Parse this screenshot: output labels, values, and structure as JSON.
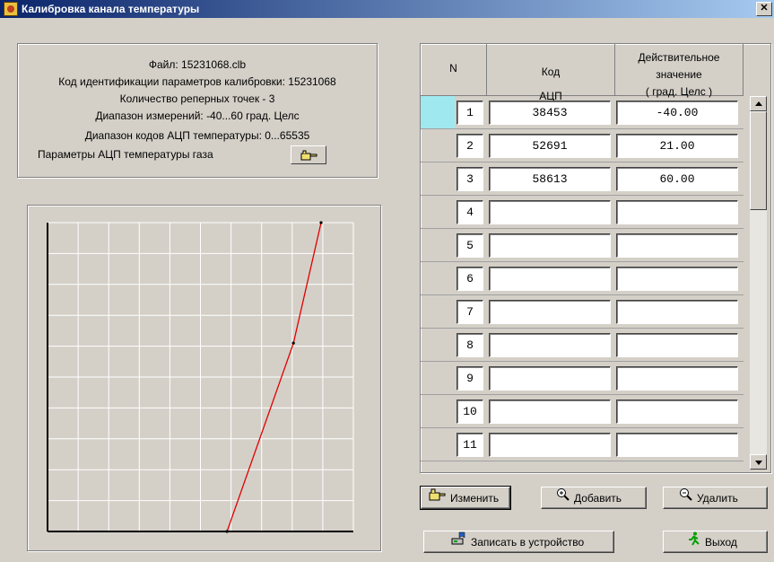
{
  "window": {
    "title": "Калибровка канала температуры",
    "close_glyph": "✕",
    "app_icon": "calibration-app-icon"
  },
  "info": {
    "file_line": "Файл:  15231068.clb",
    "id_line": "Код идентификации параметров калибровки:  15231068",
    "points_line": "Количество реперных точек -   3",
    "range_line": "Диапазон измерений:  -40...60 град. Целс",
    "adc_range_line": "Диапазон кодов АЦП температуры:  0...65535",
    "adc_params_label": "Параметры АЦП температуры газа",
    "adc_params_icon": "pointing-hand-icon"
  },
  "chart_data": {
    "type": "line",
    "title": "",
    "xlabel": "",
    "ylabel": "",
    "grid": true,
    "series": [
      {
        "x": [
          38453,
          52691,
          58613
        ],
        "y": [
          -40.0,
          21.0,
          60.0
        ],
        "color": "#e00000"
      }
    ]
  },
  "table": {
    "headers": {
      "n": "N",
      "code": [
        "Код",
        "АЦП"
      ],
      "value": [
        "Действительное",
        "значение",
        "( град. Целс )"
      ]
    },
    "rows": [
      {
        "n": "1",
        "code": "38453",
        "value": "-40.00"
      },
      {
        "n": "2",
        "code": "52691",
        "value": "21.00"
      },
      {
        "n": "3",
        "code": "58613",
        "value": "60.00"
      },
      {
        "n": "4",
        "code": "",
        "value": ""
      },
      {
        "n": "5",
        "code": "",
        "value": ""
      },
      {
        "n": "6",
        "code": "",
        "value": ""
      },
      {
        "n": "7",
        "code": "",
        "value": ""
      },
      {
        "n": "8",
        "code": "",
        "value": ""
      },
      {
        "n": "9",
        "code": "",
        "value": ""
      },
      {
        "n": "10",
        "code": "",
        "value": ""
      },
      {
        "n": "11",
        "code": "",
        "value": ""
      }
    ],
    "selected_row": 0
  },
  "buttons": {
    "edit": {
      "label": "Изменить",
      "icon": "edit-hand-icon"
    },
    "add": {
      "label": "Добавить",
      "icon": "zoom-in-icon"
    },
    "delete": {
      "label": "Удалить",
      "icon": "zoom-out-icon"
    },
    "write": {
      "label": "Записать в устройство",
      "icon": "write-device-icon"
    },
    "exit": {
      "label": "Выход",
      "icon": "running-man-icon"
    }
  },
  "colors": {
    "face": "#d4d0c8",
    "title_start": "#0a246a",
    "title_end": "#a6caf0",
    "selection": "#a0e8f0",
    "curve": "#e00000"
  }
}
